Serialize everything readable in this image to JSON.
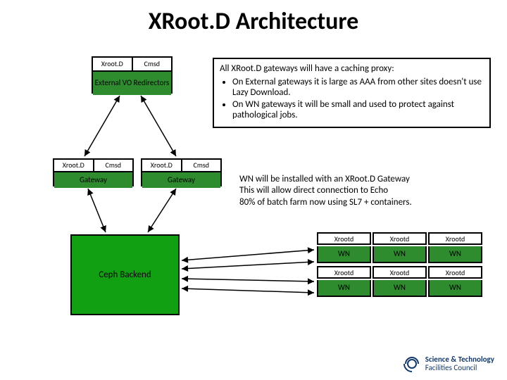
{
  "title": "XRoot.D Architecture",
  "redirector": {
    "col1": "Xroot.D",
    "col2": "Cmsd",
    "main": "External VO Redirectors"
  },
  "gateway": {
    "col1": "Xroot.D",
    "col2": "Cmsd",
    "main": "Gateway"
  },
  "desc1": {
    "lead": "All XRoot.D gateways will have a caching proxy:",
    "b1": "On External gateways it is large as AAA from other sites doesn't use Lazy Download.",
    "b2": "On WN gateways it will be small and used to protect against pathological jobs."
  },
  "desc2": {
    "l1": "WN will be installed with an XRoot.D Gateway",
    "l2": "This will allow direct connection to Echo",
    "l3": "80% of batch farm now using SL7 + containers."
  },
  "ceph": "Ceph Backend",
  "wn": {
    "header": "Xrootd",
    "body": "WN"
  },
  "logo": {
    "line1": "Science & Technology",
    "line2": "Facilities Council"
  },
  "chart_data": {
    "type": "diagram",
    "title": "XRoot.D Architecture",
    "nodes": [
      {
        "id": "redirector",
        "label": "External VO Redirectors",
        "sublabels": [
          "Xroot.D",
          "Cmsd"
        ]
      },
      {
        "id": "gateway1",
        "label": "Gateway",
        "sublabels": [
          "Xroot.D",
          "Cmsd"
        ]
      },
      {
        "id": "gateway2",
        "label": "Gateway",
        "sublabels": [
          "Xroot.D",
          "Cmsd"
        ]
      },
      {
        "id": "ceph",
        "label": "Ceph Backend"
      },
      {
        "id": "wn_cluster",
        "label": "WN",
        "count": 6,
        "sublabel": "Xrootd"
      }
    ],
    "edges": [
      {
        "from": "redirector",
        "to": "gateway1",
        "bidirectional": true
      },
      {
        "from": "redirector",
        "to": "gateway2",
        "bidirectional": true
      },
      {
        "from": "gateway1",
        "to": "ceph",
        "bidirectional": true
      },
      {
        "from": "gateway2",
        "to": "ceph",
        "bidirectional": true
      },
      {
        "from": "wn_cluster",
        "to": "ceph",
        "bidirectional": true
      }
    ],
    "annotations": [
      "All XRoot.D gateways will have a caching proxy: On External gateways it is large as AAA from other sites doesn't use Lazy Download. On WN gateways it will be small and used to protect against pathological jobs.",
      "WN will be installed with an XRoot.D Gateway. This will allow direct connection to Echo. 80% of batch farm now using SL7 + containers."
    ]
  }
}
